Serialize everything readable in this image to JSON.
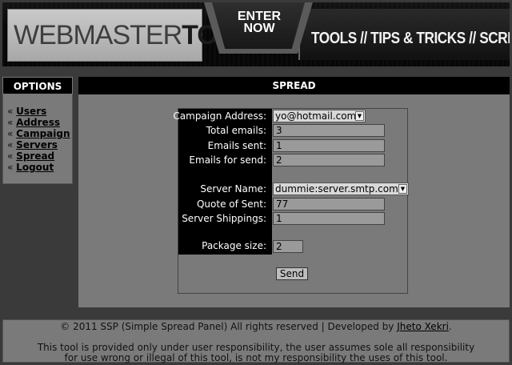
{
  "banner": {
    "logo_light": "WEBMASTER",
    "logo_bold": "TOOLS",
    "enter_label": "ENTER NOW",
    "tagline": "TOOLS // TIPS & TRICKS // SCRIPTS"
  },
  "options": {
    "title": "OPTIONS",
    "bullet": "«",
    "items": [
      "Users",
      "Address",
      "Campaign",
      "Servers",
      "Spread",
      "Logout"
    ]
  },
  "spread": {
    "title": "SPREAD",
    "fields": {
      "campaign_address": {
        "label": "Campaign Address:",
        "value": "yo@hotmail.com"
      },
      "total_emails": {
        "label": "Total emails:",
        "value": "3"
      },
      "emails_sent": {
        "label": "Emails sent:",
        "value": "1"
      },
      "emails_for_send": {
        "label": "Emails for send:",
        "value": "2"
      },
      "server_name": {
        "label": "Server Name:",
        "value": "dummie:server.smtp.com"
      },
      "quote_of_sent": {
        "label": "Quote of Sent:",
        "value": "77"
      },
      "server_shippings": {
        "label": "Server Shippings:",
        "value": "1"
      },
      "package_size": {
        "label": "Package size:",
        "value": "2"
      }
    },
    "send_label": "Send"
  },
  "footer": {
    "copyright": "© 2011 SSP (Simple Spread Panel) All rights reserved | Developed by ",
    "author": "Jheto Xekri",
    "period": ".",
    "disclaimer_line1": "This tool is provided only under user responsibility, the user assumes sole all responsibility",
    "disclaimer_line2": "for use wrong or illegal of this tool, is not my responsibility the uses of this tool."
  },
  "colors": {
    "background": "#3a3a3a",
    "panel": "#7a7a7a",
    "header_bar": "#000000"
  }
}
